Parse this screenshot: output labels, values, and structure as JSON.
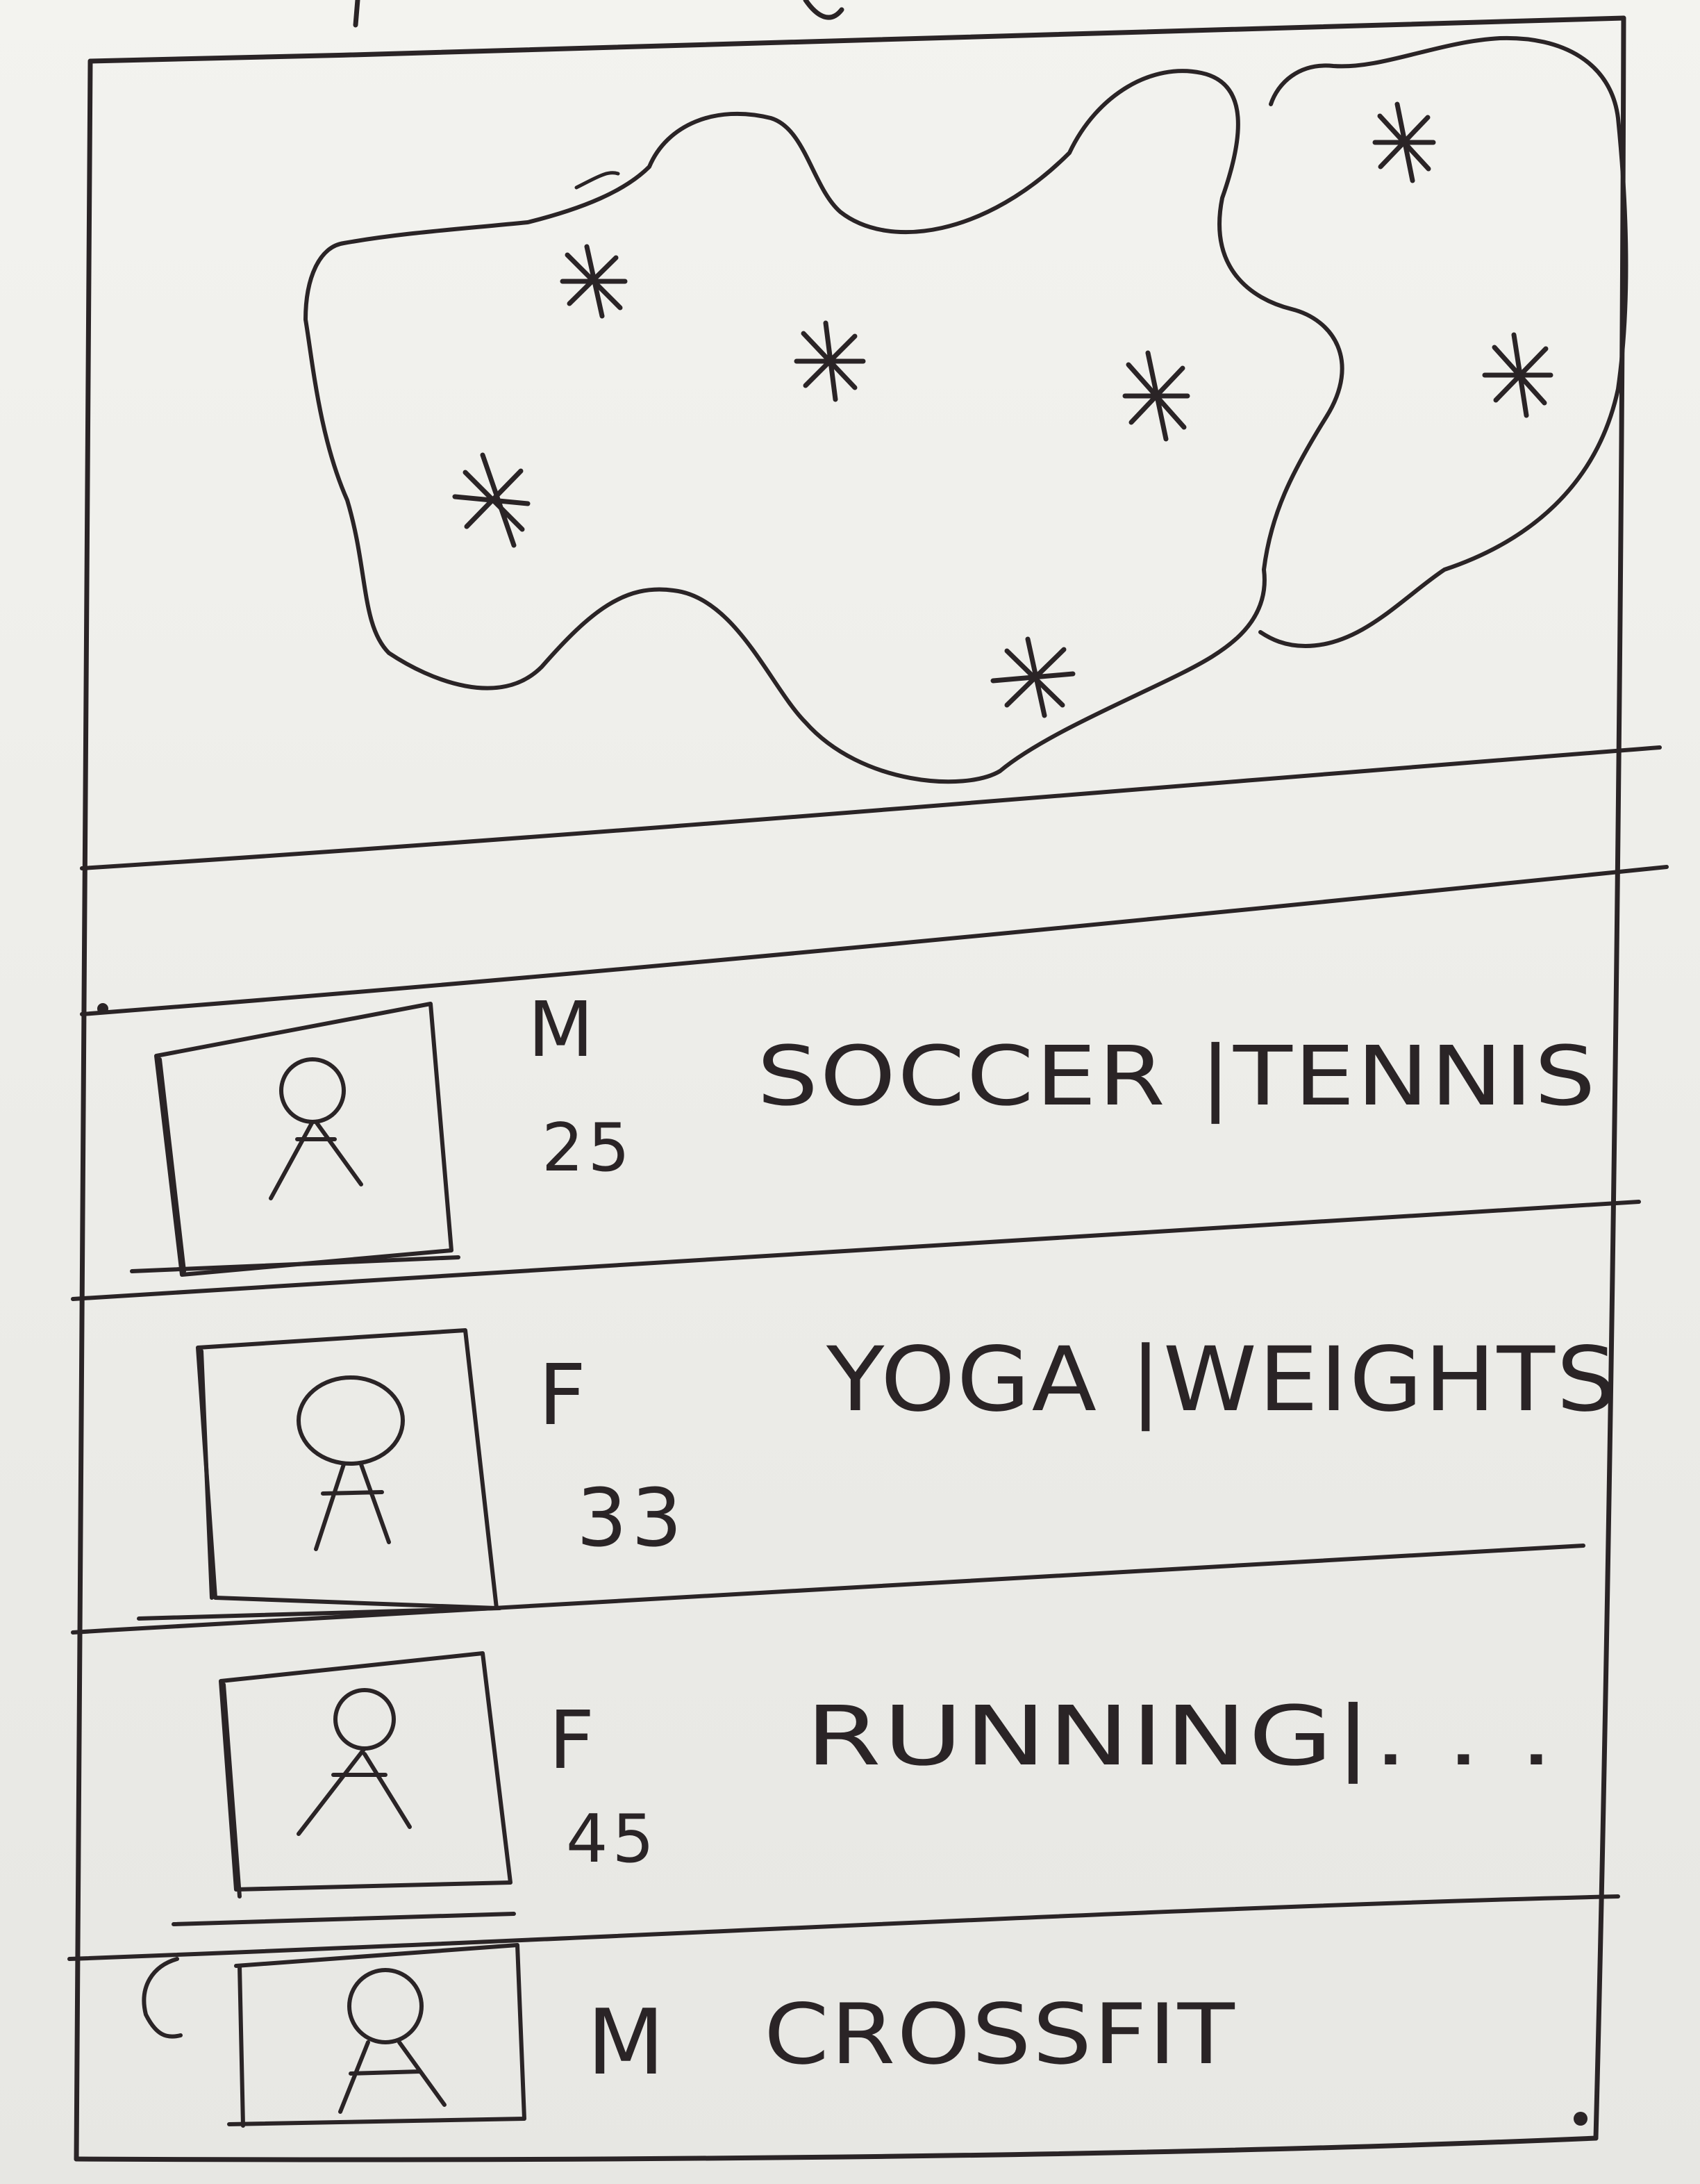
{
  "colors": {
    "paper": "#eeeeea",
    "ink": "#2a2426"
  },
  "map": {
    "marker_icon": "asterisk-marker"
  },
  "profiles": [
    {
      "gender": "M",
      "age": "25",
      "activities": "SOCCER |TENNIS",
      "avatar_icon": "person-icon"
    },
    {
      "gender": "F",
      "age": "33",
      "activities": "YOGA |WEIGHTS",
      "avatar_icon": "person-icon"
    },
    {
      "gender": "F",
      "age": "45",
      "activities": "RUNNING|. . .",
      "avatar_icon": "person-icon"
    },
    {
      "gender": "M",
      "age": "",
      "activities": "CROSSFIT",
      "avatar_icon": "person-icon"
    }
  ]
}
